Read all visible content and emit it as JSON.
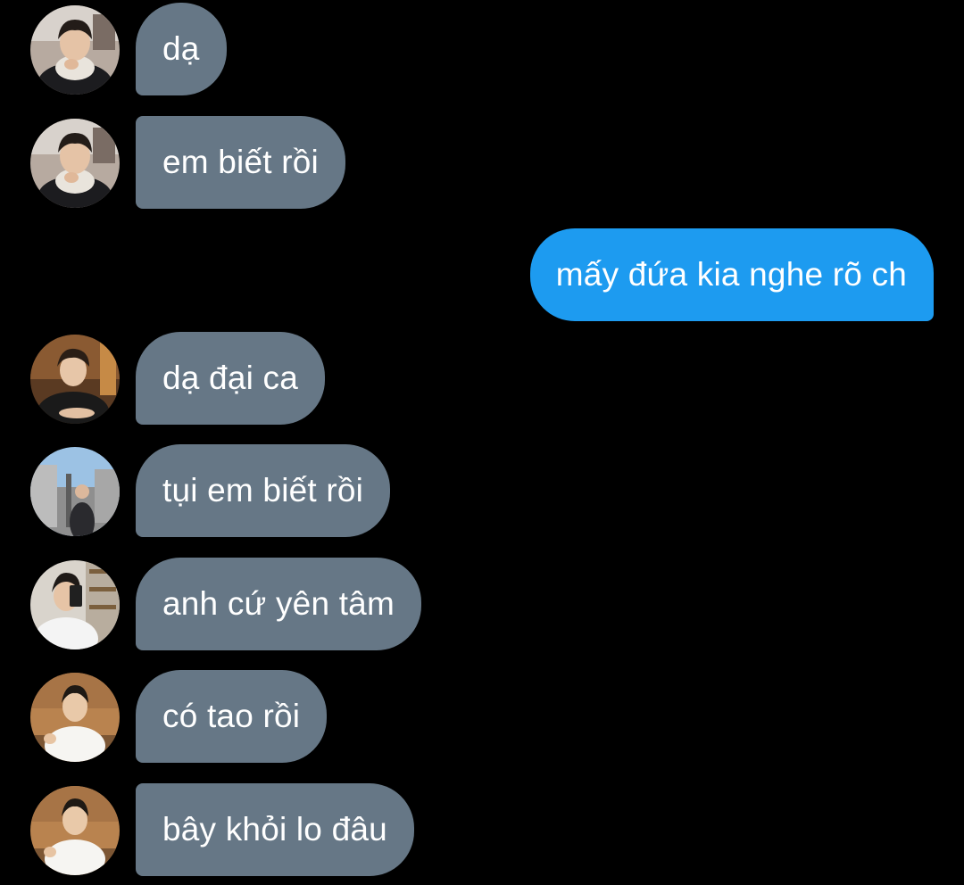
{
  "thread": {
    "messages": [
      {
        "sender": "incoming",
        "text": "dạ",
        "avatar": "avatar-guy-dark-jacket"
      },
      {
        "sender": "incoming",
        "text": "em biết rồi",
        "avatar": "avatar-guy-dark-jacket"
      },
      {
        "sender": "outgoing",
        "text": "mấy đứa kia nghe rõ ch"
      },
      {
        "sender": "incoming",
        "text": "dạ đại ca",
        "avatar": "avatar-guy-bar"
      },
      {
        "sender": "incoming",
        "text": "tụi em biết rồi",
        "avatar": "avatar-guy-street"
      },
      {
        "sender": "incoming",
        "text": "anh cứ yên tâm",
        "avatar": "avatar-guy-mirror-selfie"
      },
      {
        "sender": "incoming",
        "text": "có tao rồi",
        "avatar": "avatar-guy-white-shirt"
      },
      {
        "sender": "incoming",
        "text": "bây khỏi lo đâu",
        "avatar": "avatar-guy-white-shirt"
      }
    ]
  },
  "colors": {
    "background": "#000000",
    "incoming_bubble": "#667786",
    "outgoing_bubble": "#1d9bf0",
    "text": "#ffffff"
  }
}
